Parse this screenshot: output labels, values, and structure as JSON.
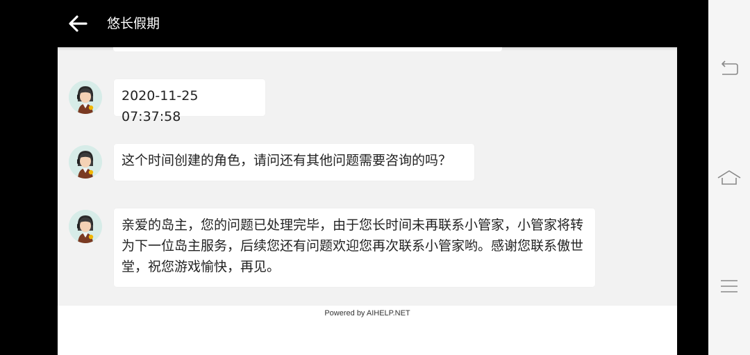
{
  "header": {
    "title": "悠长假期"
  },
  "messages": [
    {
      "text": "2020-11-25 07:37:58"
    },
    {
      "text": "这个时间创建的角色，请问还有其他问题需要咨询的吗？"
    },
    {
      "text": "亲爱的岛主，您的问题已处理完毕，由于您长时间未再联系小管家，小管家将转为下一位岛主服务，后续您还有问题欢迎您再次联系小管家哟。感谢您联系傲世堂，祝您游戏愉快，再见。"
    }
  ],
  "footer": {
    "powered_by": "Powered by AIHELP.NET"
  },
  "icons": {
    "back": "back-arrow-icon",
    "agent_avatar": "support-agent-avatar",
    "nav_back": "nav-back-icon",
    "nav_home": "nav-home-icon",
    "nav_menu": "nav-menu-icon"
  },
  "colors": {
    "header_bg": "#000000",
    "chat_bg": "#f2f2f2",
    "bubble_bg": "#ffffff",
    "nav_bg": "#f5f5f5"
  }
}
